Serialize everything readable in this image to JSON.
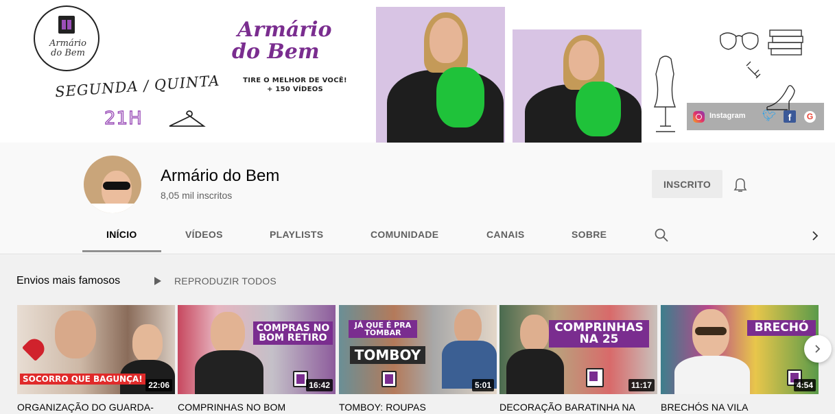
{
  "banner": {
    "logo_line1": "Armário",
    "logo_line2": "do Bem",
    "schedule_days": "SEGUNDA / QUINTA",
    "schedule_time": "21H",
    "title_line1": "Armário",
    "title_line2": "do Bem",
    "tagline_line1": "TIRE O MELHOR DE VOCÊ!",
    "tagline_line2": "+ 150 VÍDEOS",
    "social_instagram": "Instagram",
    "accent_color": "#7a2d8f",
    "scarf_color": "#1fc23a"
  },
  "channel": {
    "name": "Armário do Bem",
    "subscribers": "8,05 mil inscritos",
    "subscribe_label": "INSCRITO"
  },
  "tabs": [
    {
      "label": "INÍCIO",
      "active": true
    },
    {
      "label": "VÍDEOS"
    },
    {
      "label": "PLAYLISTS"
    },
    {
      "label": "COMUNIDADE"
    },
    {
      "label": "CANAIS"
    },
    {
      "label": "SOBRE"
    }
  ],
  "shelf": {
    "title": "Envios mais famosos",
    "play_all": "REPRODUZIR TODOS",
    "videos": [
      {
        "title": "ORGANIZAÇÃO DO GUARDA-",
        "duration": "22:06",
        "overlay": "SOCORRO QUE BAGUNÇA!"
      },
      {
        "title": "COMPRINHAS NO BOM",
        "duration": "16:42",
        "overlay": "COMPRAS NO BOM RETIRO"
      },
      {
        "title": "TOMBOY: ROUPAS",
        "duration": "5:01",
        "overlay_small": "JÁ QUE É PRA TOMBAR",
        "overlay": "TOMBOY"
      },
      {
        "title": "DECORAÇÃO BARATINHA NA",
        "duration": "11:17",
        "overlay": "COMPRINHAS NA 25"
      },
      {
        "title": "BRECHÓS NA VILA",
        "duration": "4:54",
        "overlay": "BRECHÓ"
      }
    ]
  }
}
